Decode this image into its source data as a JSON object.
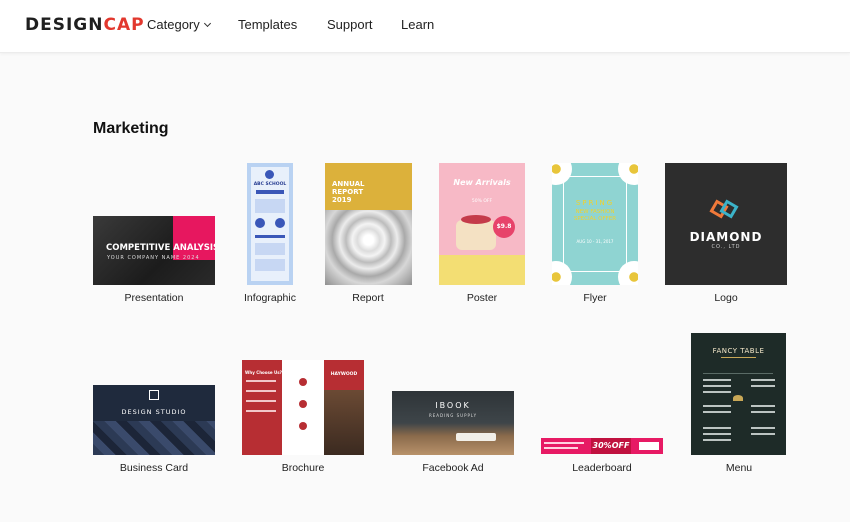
{
  "header": {
    "logo_main": "DESIGN",
    "logo_accent": "CAP",
    "nav": {
      "category": "Category",
      "templates": "Templates",
      "support": "Support",
      "learn": "Learn"
    }
  },
  "section": {
    "title": "Marketing"
  },
  "templates": {
    "presentation": {
      "label": "Presentation",
      "thumb_title": "COMPETITIVE ANALYSIS",
      "thumb_sub": "YOUR COMPANY NAME 2024"
    },
    "infographic": {
      "label": "Infographic",
      "thumb_title": "ABC SCHOOL"
    },
    "report": {
      "label": "Report",
      "thumb_title": "ANNUAL REPORT 2019"
    },
    "poster": {
      "label": "Poster",
      "thumb_title": "New Arrivals",
      "thumb_badge": "$9.8",
      "thumb_off": "50% OFF"
    },
    "flyer": {
      "label": "Flyer",
      "thumb_title": "SPRING",
      "thumb_sub": "NEW FASHION SPECIAL OFFER",
      "thumb_date": "AUG 10 - 31, 2017"
    },
    "logo": {
      "label": "Logo",
      "thumb_title": "DIAMOND",
      "thumb_sub": "CO., LTD"
    },
    "business_card": {
      "label": "Business Card",
      "thumb_title": "DESIGN STUDIO"
    },
    "brochure": {
      "label": "Brochure",
      "thumb_title": "Why Choose Us?",
      "thumb_brand": "HAYWOOD"
    },
    "facebook_ad": {
      "label": "Facebook Ad",
      "thumb_title": "IBOOK",
      "thumb_sub": "READING SUPPLY"
    },
    "leaderboard": {
      "label": "Leaderboard",
      "thumb_title": "30%OFF"
    },
    "menu": {
      "label": "Menu",
      "thumb_title": "FANCY TABLE"
    }
  },
  "colors": {
    "logo_accent": "#e2382e",
    "presentation_pink": "#e7175f",
    "report_yellow": "#dcb13b",
    "poster_pink": "#f7b9c6",
    "flyer_teal": "#8fd4d2",
    "logo_dark": "#2d2d2d",
    "brochure_red": "#b72e33",
    "menu_green": "#1e2b28",
    "leaderboard_pink": "#e71a64"
  }
}
